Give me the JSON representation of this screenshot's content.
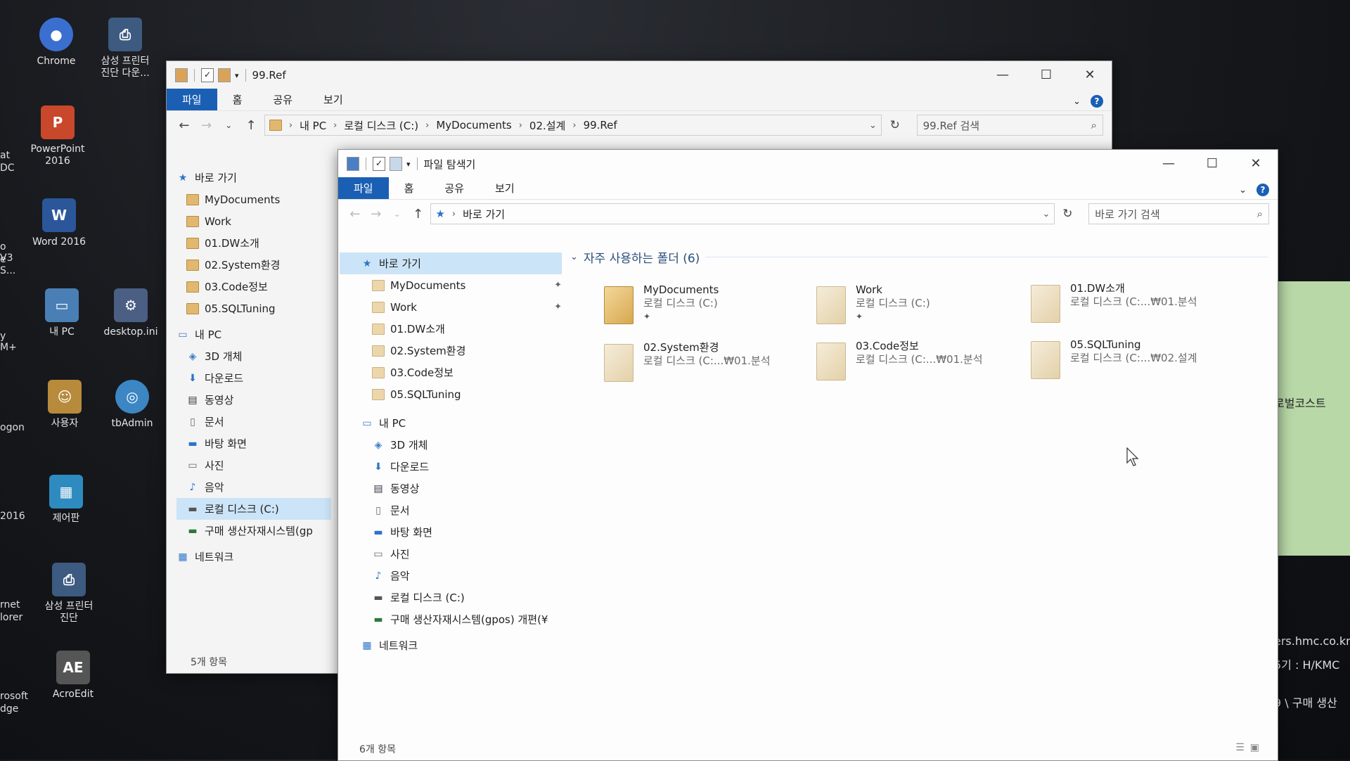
{
  "desktop": {
    "icons": [
      {
        "label": "Chrome",
        "label2": "",
        "icon": "chrome-icon",
        "color": "#3a6fd0"
      },
      {
        "label": "삼성 프린터",
        "label2": "진단 다운...",
        "icon": "printer-icon",
        "color": "#3d5a80"
      },
      {
        "label": "PowerPoint",
        "label2": "2016",
        "icon": "powerpoint-icon",
        "color": "#c9472b"
      },
      {
        "label": "Word 2016",
        "label2": "",
        "icon": "word-icon",
        "color": "#2b579a"
      },
      {
        "label": "내 PC",
        "label2": "",
        "icon": "computer-icon",
        "color": "#4a7fb5"
      },
      {
        "label": "desktop.ini",
        "label2": "",
        "icon": "gear-file-icon",
        "color": "#4b5e83"
      },
      {
        "label": "사용자",
        "label2": "",
        "icon": "user-folder-icon",
        "color": "#b78a3c"
      },
      {
        "label": "tbAdmin",
        "label2": "",
        "icon": "admin-globe-icon",
        "color": "#3c86c4"
      },
      {
        "label": "제어판",
        "label2": "",
        "icon": "control-panel-icon",
        "color": "#2e8bc0"
      },
      {
        "label": "삼성 프린터",
        "label2": "진단",
        "icon": "printer-diag-icon",
        "color": "#3d5a80"
      },
      {
        "label": "AcroEdit",
        "label2": "",
        "icon": "acroedit-icon",
        "color": "#555555"
      }
    ],
    "left_partial": [
      "at",
      "DC",
      "o V3",
      "e S...",
      "y M+",
      "ogon",
      "2016",
      "rnet",
      "lorer",
      "rosoft",
      "dge"
    ],
    "right_partial": [
      "로벌코스트",
      "ers.hmc.co.kr",
      "5기 : H/KMC",
      "9 \\ 구매 생산"
    ]
  },
  "back_window": {
    "title": "99.Ref",
    "ribbon_tabs": [
      "파일",
      "홈",
      "공유",
      "보기"
    ],
    "breadcrumb": [
      "내 PC",
      "로컬 디스크 (C:)",
      "MyDocuments",
      "02.설계",
      "99.Ref"
    ],
    "search_placeholder": "99.Ref 검색",
    "nav": {
      "quick_access": "바로 가기",
      "pinned": [
        "MyDocuments",
        "Work",
        "01.DW소개",
        "02.System환경",
        "03.Code정보",
        "05.SQLTuning"
      ],
      "this_pc": "내 PC",
      "pc_items": [
        "3D 개체",
        "다운로드",
        "동영상",
        "문서",
        "바탕 화면",
        "사진",
        "음악",
        "로컬 디스크 (C:)",
        "구매 생산자재시스템(gp"
      ],
      "network": "네트워크"
    },
    "status": "5개 항목"
  },
  "front_window": {
    "title": "파일 탐색기",
    "ribbon_tabs": [
      "파일",
      "홈",
      "공유",
      "보기"
    ],
    "breadcrumb": [
      "바로 가기"
    ],
    "search_placeholder": "바로 가기 검색",
    "nav": {
      "quick_access": "바로 가기",
      "pinned": [
        "MyDocuments",
        "Work",
        "01.DW소개",
        "02.System환경",
        "03.Code정보",
        "05.SQLTuning"
      ],
      "this_pc": "내 PC",
      "pc_items": [
        "3D 개체",
        "다운로드",
        "동영상",
        "문서",
        "바탕 화면",
        "사진",
        "음악",
        "로컬 디스크 (C:)",
        "구매 생산자재시스템(gpos) 개편(¥"
      ],
      "network": "네트워크"
    },
    "group_header": "자주 사용하는 폴더 (6)",
    "folders": [
      {
        "name": "MyDocuments",
        "path": "로컬 디스크 (C:)",
        "pinned": true
      },
      {
        "name": "Work",
        "path": "로컬 디스크 (C:)",
        "pinned": true
      },
      {
        "name": "01.DW소개",
        "path": "로컬 디스크 (C:...₩01.분석",
        "pinned": false
      },
      {
        "name": "02.System환경",
        "path": "로컬 디스크 (C:...₩01.분석",
        "pinned": false
      },
      {
        "name": "03.Code정보",
        "path": "로컬 디스크 (C:...₩01.분석",
        "pinned": false
      },
      {
        "name": "05.SQLTuning",
        "path": "로컬 디스크 (C:...₩02.설계",
        "pinned": false
      }
    ],
    "status": "6개 항목"
  }
}
